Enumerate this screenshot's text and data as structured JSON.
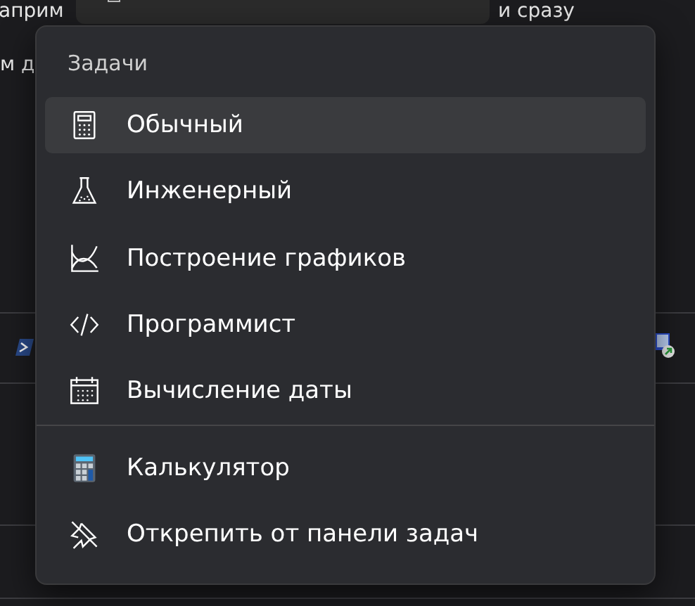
{
  "background_text": [
    "априм",
    "и сразу",
    "м д"
  ],
  "menu": {
    "header": "Задачи",
    "tasks": [
      {
        "label": "Обычный",
        "selected": true
      },
      {
        "label": "Инженерный",
        "selected": false
      },
      {
        "label": "Построение графиков",
        "selected": false
      },
      {
        "label": "Программист",
        "selected": false
      },
      {
        "label": "Вычисление даты",
        "selected": false
      }
    ],
    "actions": [
      {
        "label": "Калькулятор"
      },
      {
        "label": "Открепить от панели задач"
      }
    ]
  }
}
